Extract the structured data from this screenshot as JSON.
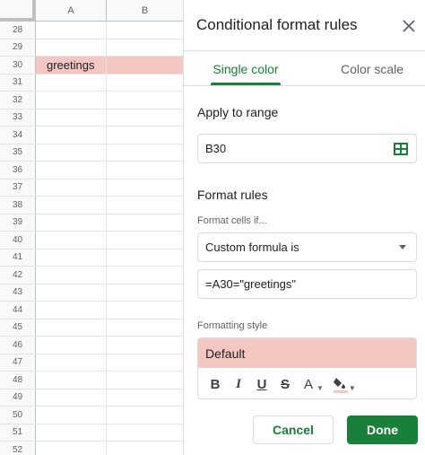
{
  "sheet": {
    "columns": [
      "A",
      "B"
    ],
    "rows": [
      {
        "num": "28",
        "a": "",
        "b": "",
        "highlight": false
      },
      {
        "num": "29",
        "a": "",
        "b": "",
        "highlight": false
      },
      {
        "num": "30",
        "a": "greetings",
        "b": "",
        "highlight": true
      },
      {
        "num": "31",
        "a": "",
        "b": "",
        "highlight": false
      },
      {
        "num": "32",
        "a": "",
        "b": "",
        "highlight": false
      },
      {
        "num": "33",
        "a": "",
        "b": "",
        "highlight": false
      },
      {
        "num": "34",
        "a": "",
        "b": "",
        "highlight": false
      },
      {
        "num": "35",
        "a": "",
        "b": "",
        "highlight": false
      },
      {
        "num": "36",
        "a": "",
        "b": "",
        "highlight": false
      },
      {
        "num": "37",
        "a": "",
        "b": "",
        "highlight": false
      },
      {
        "num": "38",
        "a": "",
        "b": "",
        "highlight": false
      },
      {
        "num": "39",
        "a": "",
        "b": "",
        "highlight": false
      },
      {
        "num": "40",
        "a": "",
        "b": "",
        "highlight": false
      },
      {
        "num": "41",
        "a": "",
        "b": "",
        "highlight": false
      },
      {
        "num": "42",
        "a": "",
        "b": "",
        "highlight": false
      },
      {
        "num": "43",
        "a": "",
        "b": "",
        "highlight": false
      },
      {
        "num": "44",
        "a": "",
        "b": "",
        "highlight": false
      },
      {
        "num": "45",
        "a": "",
        "b": "",
        "highlight": false
      },
      {
        "num": "46",
        "a": "",
        "b": "",
        "highlight": false
      },
      {
        "num": "47",
        "a": "",
        "b": "",
        "highlight": false
      },
      {
        "num": "48",
        "a": "",
        "b": "",
        "highlight": false
      },
      {
        "num": "49",
        "a": "",
        "b": "",
        "highlight": false
      },
      {
        "num": "50",
        "a": "",
        "b": "",
        "highlight": false
      },
      {
        "num": "51",
        "a": "",
        "b": "",
        "highlight": false
      },
      {
        "num": "52",
        "a": "",
        "b": "",
        "highlight": false
      }
    ],
    "highlight_color": "#f4c7c3"
  },
  "panel": {
    "title": "Conditional format rules",
    "close_icon": "close-icon",
    "tabs": [
      {
        "label": "Single color",
        "active": true
      },
      {
        "label": "Color scale",
        "active": false
      }
    ],
    "apply_to_range": {
      "label": "Apply to range",
      "value": "B30",
      "icon": "select-range-icon"
    },
    "format_rules": {
      "label": "Format rules",
      "condition_label": "Format cells if...",
      "condition_value": "Custom formula is",
      "formula_value": "=A30=\"greetings\""
    },
    "formatting_style": {
      "label": "Formatting style",
      "preview_text": "Default",
      "preview_color": "#f4c7c3",
      "toolbar": {
        "bold": "B",
        "italic": "I",
        "underline": "U",
        "strikethrough": "S",
        "text_color": "A",
        "fill_color_icon": "paint-bucket-icon"
      }
    },
    "buttons": {
      "cancel": "Cancel",
      "done": "Done"
    },
    "accent_color": "#188038"
  }
}
